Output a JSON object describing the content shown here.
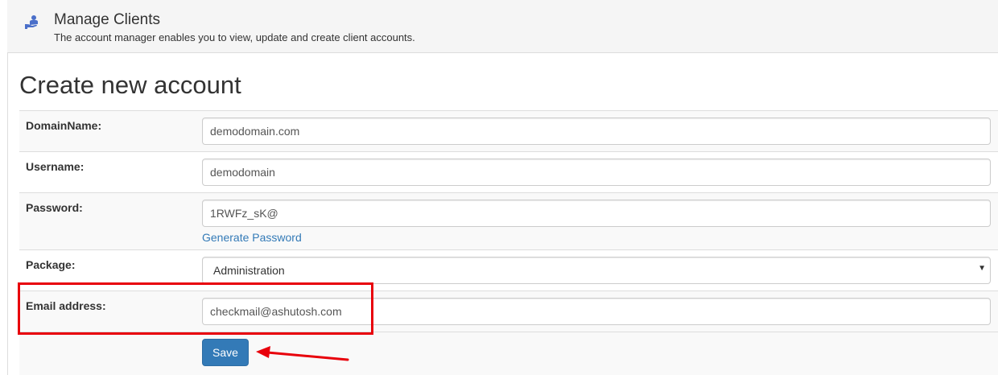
{
  "header": {
    "title": "Manage Clients",
    "subtitle": "The account manager enables you to view, update and create client accounts.",
    "icon": "hand-holding-user-icon",
    "icon_color": "#4a6fc9"
  },
  "form": {
    "title": "Create new account",
    "fields": {
      "domain": {
        "label": "DomainName:",
        "value": "demodomain.com"
      },
      "username": {
        "label": "Username:",
        "value": "demodomain"
      },
      "password": {
        "label": "Password:",
        "value": "1RWFz_sK@",
        "generate_link": "Generate Password"
      },
      "package": {
        "label": "Package:",
        "selected": "Administration"
      },
      "email": {
        "label": "Email address:",
        "value": "checkmail@ashutosh.com"
      }
    },
    "save_label": "Save"
  },
  "annotations": {
    "highlight_color": "#e8000b",
    "highlight_target": "email-row",
    "arrow_target": "save-button"
  },
  "colors": {
    "link": "#337ab7",
    "button": "#337ab7",
    "header_bg": "#f5f5f5",
    "row_shade": "#f9f9f9"
  }
}
